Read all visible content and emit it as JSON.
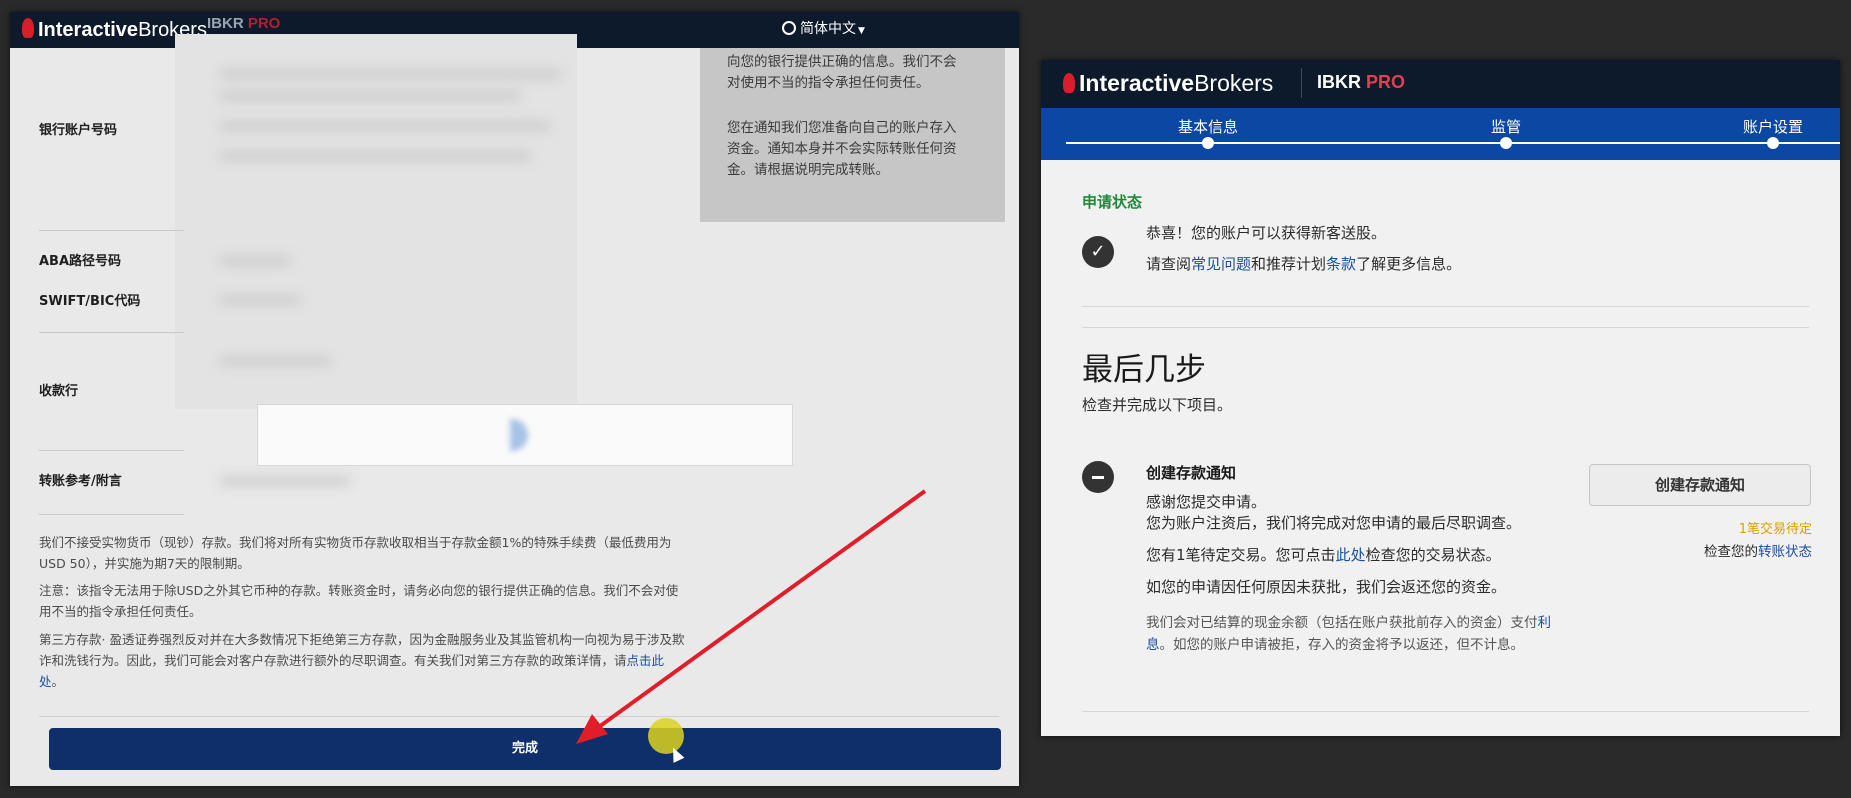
{
  "left": {
    "brand": {
      "logo_text_bold": "Interactive",
      "logo_text_thin": "Brokers",
      "ibkr": "IBKR",
      "pro": "PRO"
    },
    "language": "简体中文",
    "fields": {
      "bank_account_label": "银行账户号码",
      "aba_label": "ABA路径号码",
      "swift_label": "SWIFT/BIC代码",
      "beneficiary_bank_label": "收款行",
      "reference_label": "转账参考/附言"
    },
    "side_info": {
      "para1": "向您的银行提供正确的信息。我们不会对使用不当的指令承担任何责任。",
      "para2": "您在通知我们您准备向自己的账户存入资金。通知本身并不会实际转账任何资金。请根据说明完成转账。"
    },
    "notes": {
      "note1": "我们不接受实物货币（现钞）存款。我们将对所有实物货币存款收取相当于存款金额1%的特殊手续费（最低费用为USD 50），并实施为期7天的限制期。",
      "note2": "注意：该指令无法用于除USD之外其它币种的存款。转账资金时，请务必向您的银行提供正确的信息。我们不会对使用不当的指令承担任何责任。",
      "note3_prefix": "第三方存款· 盈透证券强烈反对并在大多数情况下拒绝第三方存款，因为金融服务业及其监管机构一向视为易于涉及欺诈和洗钱行为。因此，我们可能会对客户存款进行额外的尽职调查。有关我们对第三方存款的政策详情，请",
      "note3_link": "点击此处",
      "note3_suffix": "。"
    },
    "done_button": "完成"
  },
  "right": {
    "brand": {
      "logo_text_bold": "Interactive",
      "logo_text_thin": "Brokers",
      "ibkr": "IBKR",
      "pro": "PRO"
    },
    "steps": [
      "基本信息",
      "监管",
      "账户设置"
    ],
    "status": {
      "title": "申请状态",
      "line1": "恭喜！您的账户可以获得新客送股。",
      "line2_prefix": "请查阅",
      "line2_link1": "常见问题",
      "line2_mid": "和推荐计划",
      "line2_link2": "条款",
      "line2_suffix": "了解更多信息。"
    },
    "final_steps": {
      "title": "最后几步",
      "subtitle": "检查并完成以下项目。"
    },
    "deposit_item": {
      "title": "创建存款通知",
      "line1": "感谢您提交申请。",
      "line2": "您为账户注资后，我们将完成对您申请的最后尽职调查。",
      "line3_prefix": "您有1笔待定交易。您可点击",
      "line3_link": "此处",
      "line3_suffix": "检查您的交易状态。",
      "line4": "如您的申请因任何原因未获批，我们会返还您的资金。",
      "small_prefix": "我们会对已结算的现金余额（包括在账户获批前存入的资金）支付",
      "small_link": "利息",
      "small_suffix": "。如您的账户申请被拒，存入的资金将予以返还，但不计息。",
      "button": "创建存款通知",
      "pending": "1笔交易待定",
      "check_prefix": "检查您的",
      "check_link": "转账状态"
    }
  },
  "colors": {
    "nav_dark": "#0d1a2c",
    "step_blue": "#0c47a4",
    "done_blue": "#0f2f6a",
    "status_green": "#1d8a3c",
    "link_blue": "#1b4fa0",
    "pending_amber": "#d8a000",
    "arrow_red": "#e11d2a"
  }
}
